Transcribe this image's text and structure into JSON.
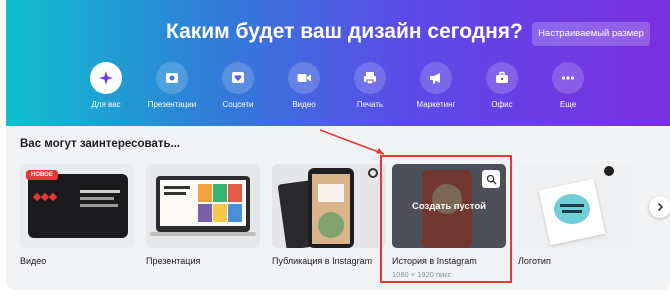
{
  "hero": {
    "title": "Каким будет ваш дизайн сегодня?",
    "custom_size_label": "Настраиваемый размер"
  },
  "categories": [
    {
      "label": "Для вас",
      "icon": "sparkle-icon",
      "active": true
    },
    {
      "label": "Презентации",
      "icon": "presentation-icon",
      "active": false
    },
    {
      "label": "Соцсети",
      "icon": "heart-icon",
      "active": false
    },
    {
      "label": "Видео",
      "icon": "video-icon",
      "active": false
    },
    {
      "label": "Печать",
      "icon": "printer-icon",
      "active": false
    },
    {
      "label": "Маркетинг",
      "icon": "megaphone-icon",
      "active": false
    },
    {
      "label": "Офис",
      "icon": "briefcase-icon",
      "active": false
    },
    {
      "label": "Еще",
      "icon": "more-icon",
      "active": false
    }
  ],
  "suggestions": {
    "title": "Вас могут заинтересовать...",
    "badge_new": "НОВОЕ",
    "cards": [
      {
        "name": "Видео"
      },
      {
        "name": "Презентация"
      },
      {
        "name": "Публикация в Instagram"
      },
      {
        "name": "История в Instagram",
        "size": "1080 × 1920 пикс.",
        "hover_label": "Создать пустой"
      },
      {
        "name": "Логотип"
      }
    ]
  },
  "colors": {
    "gradient_start": "#0fc0cf",
    "gradient_end": "#7a2fe0",
    "highlight": "#e53935"
  }
}
